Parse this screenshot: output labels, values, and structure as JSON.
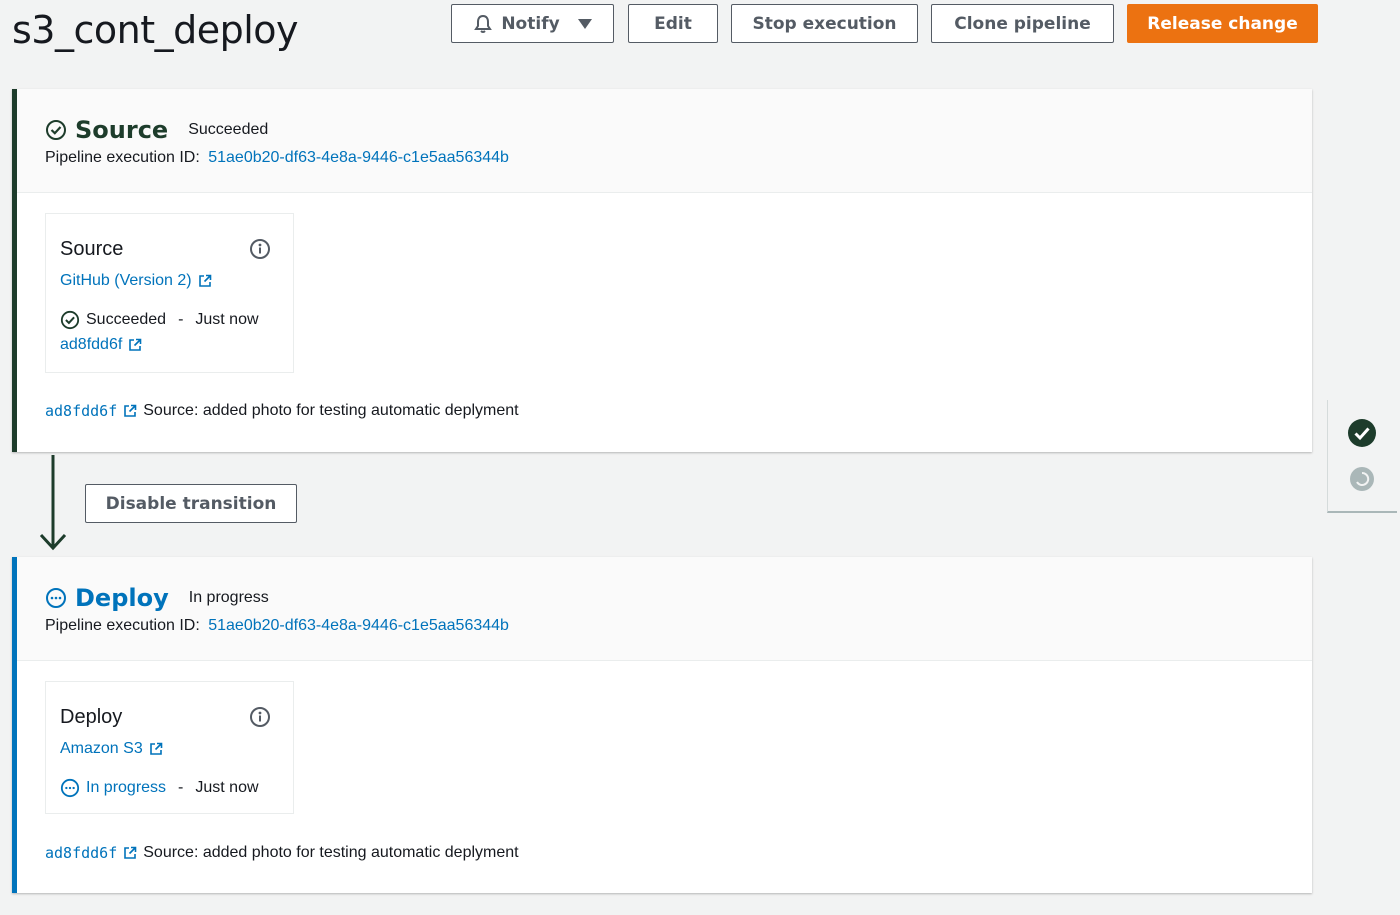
{
  "header": {
    "title": "s3_cont_deploy",
    "buttons": {
      "notify": "Notify",
      "edit": "Edit",
      "stop": "Stop execution",
      "clone": "Clone pipeline",
      "release": "Release change"
    }
  },
  "colors": {
    "accent": "#ec7211",
    "link": "#0073bb",
    "success": "#1d3c2b",
    "in_progress": "#0073bb"
  },
  "stages": [
    {
      "name": "Source",
      "status": "Succeeded",
      "exec_label": "Pipeline execution ID:",
      "exec_id": "51ae0b20-df63-4e8a-9446-c1e5aa56344b",
      "action": {
        "title": "Source",
        "provider": "GitHub (Version 2)",
        "status": "Succeeded",
        "separator": "-",
        "time": "Just now",
        "commit": "ad8fdd6f"
      },
      "revision": {
        "id": "ad8fdd6f",
        "message": "Source: added photo for testing automatic deplyment"
      }
    },
    {
      "name": "Deploy",
      "status": "In progress",
      "exec_label": "Pipeline execution ID:",
      "exec_id": "51ae0b20-df63-4e8a-9446-c1e5aa56344b",
      "action": {
        "title": "Deploy",
        "provider": "Amazon S3",
        "status": "In progress",
        "separator": "-",
        "time": "Just now"
      },
      "revision": {
        "id": "ad8fdd6f",
        "message": "Source: added photo for testing automatic deplyment"
      }
    }
  ],
  "transition": {
    "button": "Disable transition"
  },
  "side_panel": {
    "icons": [
      "check-circle-icon",
      "in-progress-icon"
    ]
  }
}
